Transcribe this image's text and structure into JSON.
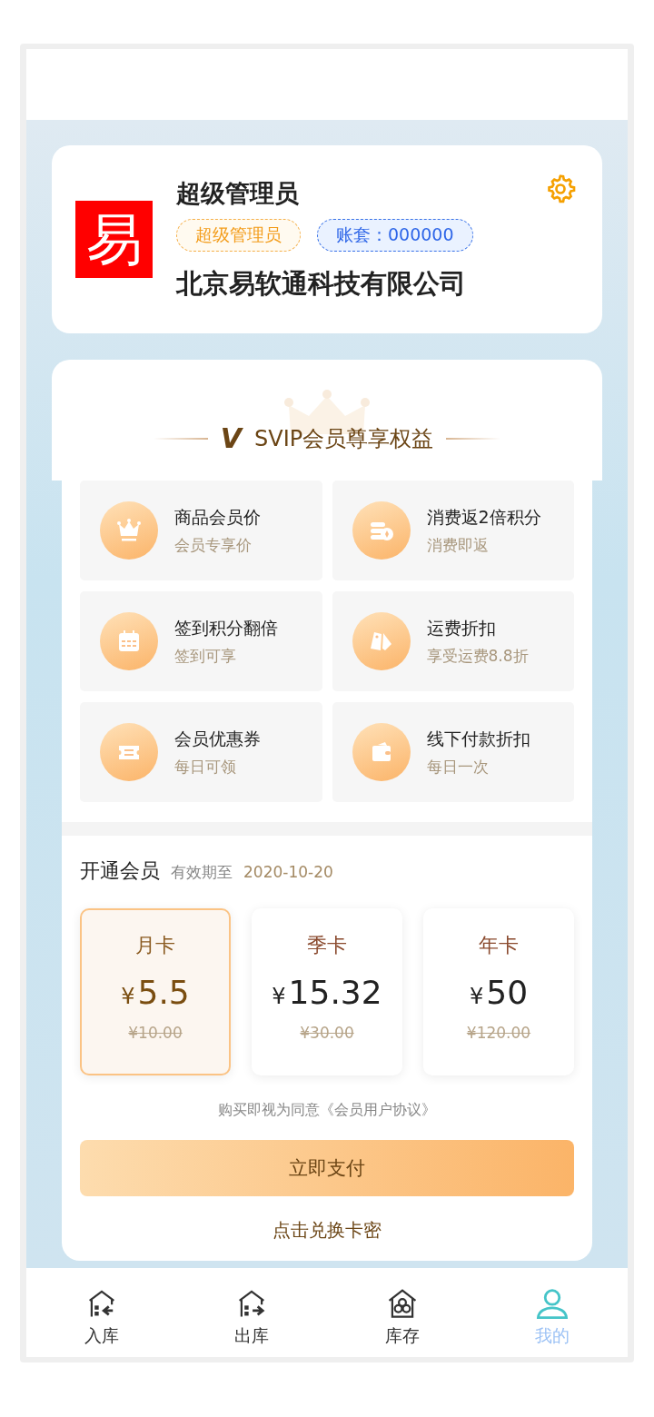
{
  "profile": {
    "logo": "易",
    "name": "超级管理员",
    "role_badge": "超级管理员",
    "account_badge": "账套：000000",
    "company": "北京易软通科技有限公司"
  },
  "benefits": {
    "title": "SVIP会员尊享权益",
    "mark": "V",
    "items": [
      {
        "kind": "crown",
        "title": "商品会员价",
        "subtitle": "会员专享价"
      },
      {
        "kind": "coins",
        "title": "消费返2倍积分",
        "subtitle": "消费即返"
      },
      {
        "kind": "calendar",
        "title": "签到积分翻倍",
        "subtitle": "签到可享"
      },
      {
        "kind": "tags",
        "title": "运费折扣",
        "subtitle": "享受运费8.8折"
      },
      {
        "kind": "ticket",
        "title": "会员优惠券",
        "subtitle": "每日可领"
      },
      {
        "kind": "wallet",
        "title": "线下付款折扣",
        "subtitle": "每日一次"
      }
    ]
  },
  "membership": {
    "title": "开通会员",
    "expiry_label": "有效期至",
    "expiry_date": "2020-10-20",
    "plans": [
      {
        "name": "月卡",
        "currency": "¥",
        "price": "5.5",
        "original_price": "¥10.00",
        "selected": true
      },
      {
        "name": "季卡",
        "currency": "¥",
        "price": "15.32",
        "original_price": "¥30.00",
        "selected": false
      },
      {
        "name": "年卡",
        "currency": "¥",
        "price": "50",
        "original_price": "¥120.00",
        "selected": false
      }
    ],
    "agreement": "购买即视为同意《会员用户协议》",
    "pay_button": "立即支付",
    "redeem_link": "点击兑换卡密"
  },
  "tab_bar": [
    {
      "kind": "inbound",
      "label": "入库",
      "selected": false
    },
    {
      "kind": "outbound",
      "label": "出库",
      "selected": false
    },
    {
      "kind": "stock",
      "label": "库存",
      "selected": false
    },
    {
      "kind": "user",
      "label": "我的",
      "selected": true
    }
  ]
}
